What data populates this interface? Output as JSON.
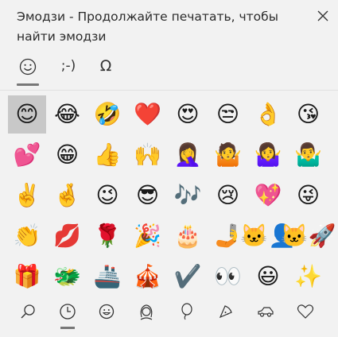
{
  "header": {
    "title": "Эмодзи - Продолжайте печатать, чтобы найти эмодзи",
    "close_icon": "close-icon"
  },
  "tabs": [
    {
      "name": "emoji-tab",
      "icon": "smiley-outline-icon",
      "selected": true
    },
    {
      "name": "kaomoji-tab",
      "label": ";-)",
      "selected": false
    },
    {
      "name": "symbols-tab",
      "label": "Ω",
      "selected": false
    }
  ],
  "emojis": [
    [
      "😊",
      "😂",
      "🤣",
      "❤️",
      "😍",
      "😒",
      "👌",
      "😘"
    ],
    [
      "💕",
      "😁",
      "👍",
      "🙌",
      "🤦‍♀️",
      "🤷",
      "🤷‍♀️",
      "🤷‍♂️"
    ],
    [
      "✌️",
      "🤞",
      "😉",
      "😎",
      "🎶",
      "😢",
      "💖",
      "😜"
    ],
    [
      "👏",
      "💋",
      "🌹",
      "🎉",
      "🎂",
      "🤳",
      "🐱‍👤",
      "🐱‍🚀"
    ],
    [
      "🎁",
      "🐲",
      "🚢",
      "🎪",
      "✔️",
      "👀",
      "😃",
      "✨"
    ]
  ],
  "selected_emoji": "😊",
  "bottom_tabs": [
    {
      "name": "search-tab",
      "icon": "search-icon",
      "selected": false
    },
    {
      "name": "recent-tab",
      "icon": "clock-icon",
      "selected": true
    },
    {
      "name": "smileys-people-tab",
      "icon": "smiley-icon",
      "selected": false
    },
    {
      "name": "people-tab",
      "icon": "person-icon",
      "selected": false
    },
    {
      "name": "celebrations-tab",
      "icon": "balloon-icon",
      "selected": false
    },
    {
      "name": "food-tab",
      "icon": "pizza-icon",
      "selected": false
    },
    {
      "name": "travel-tab",
      "icon": "car-icon",
      "selected": false
    },
    {
      "name": "symbols-heart-tab",
      "icon": "heart-icon",
      "selected": false
    }
  ],
  "colors": {
    "background": "#f2f2f2",
    "selected_cell": "#c8c8c8",
    "underline": "#777777",
    "icon": "#333333"
  }
}
